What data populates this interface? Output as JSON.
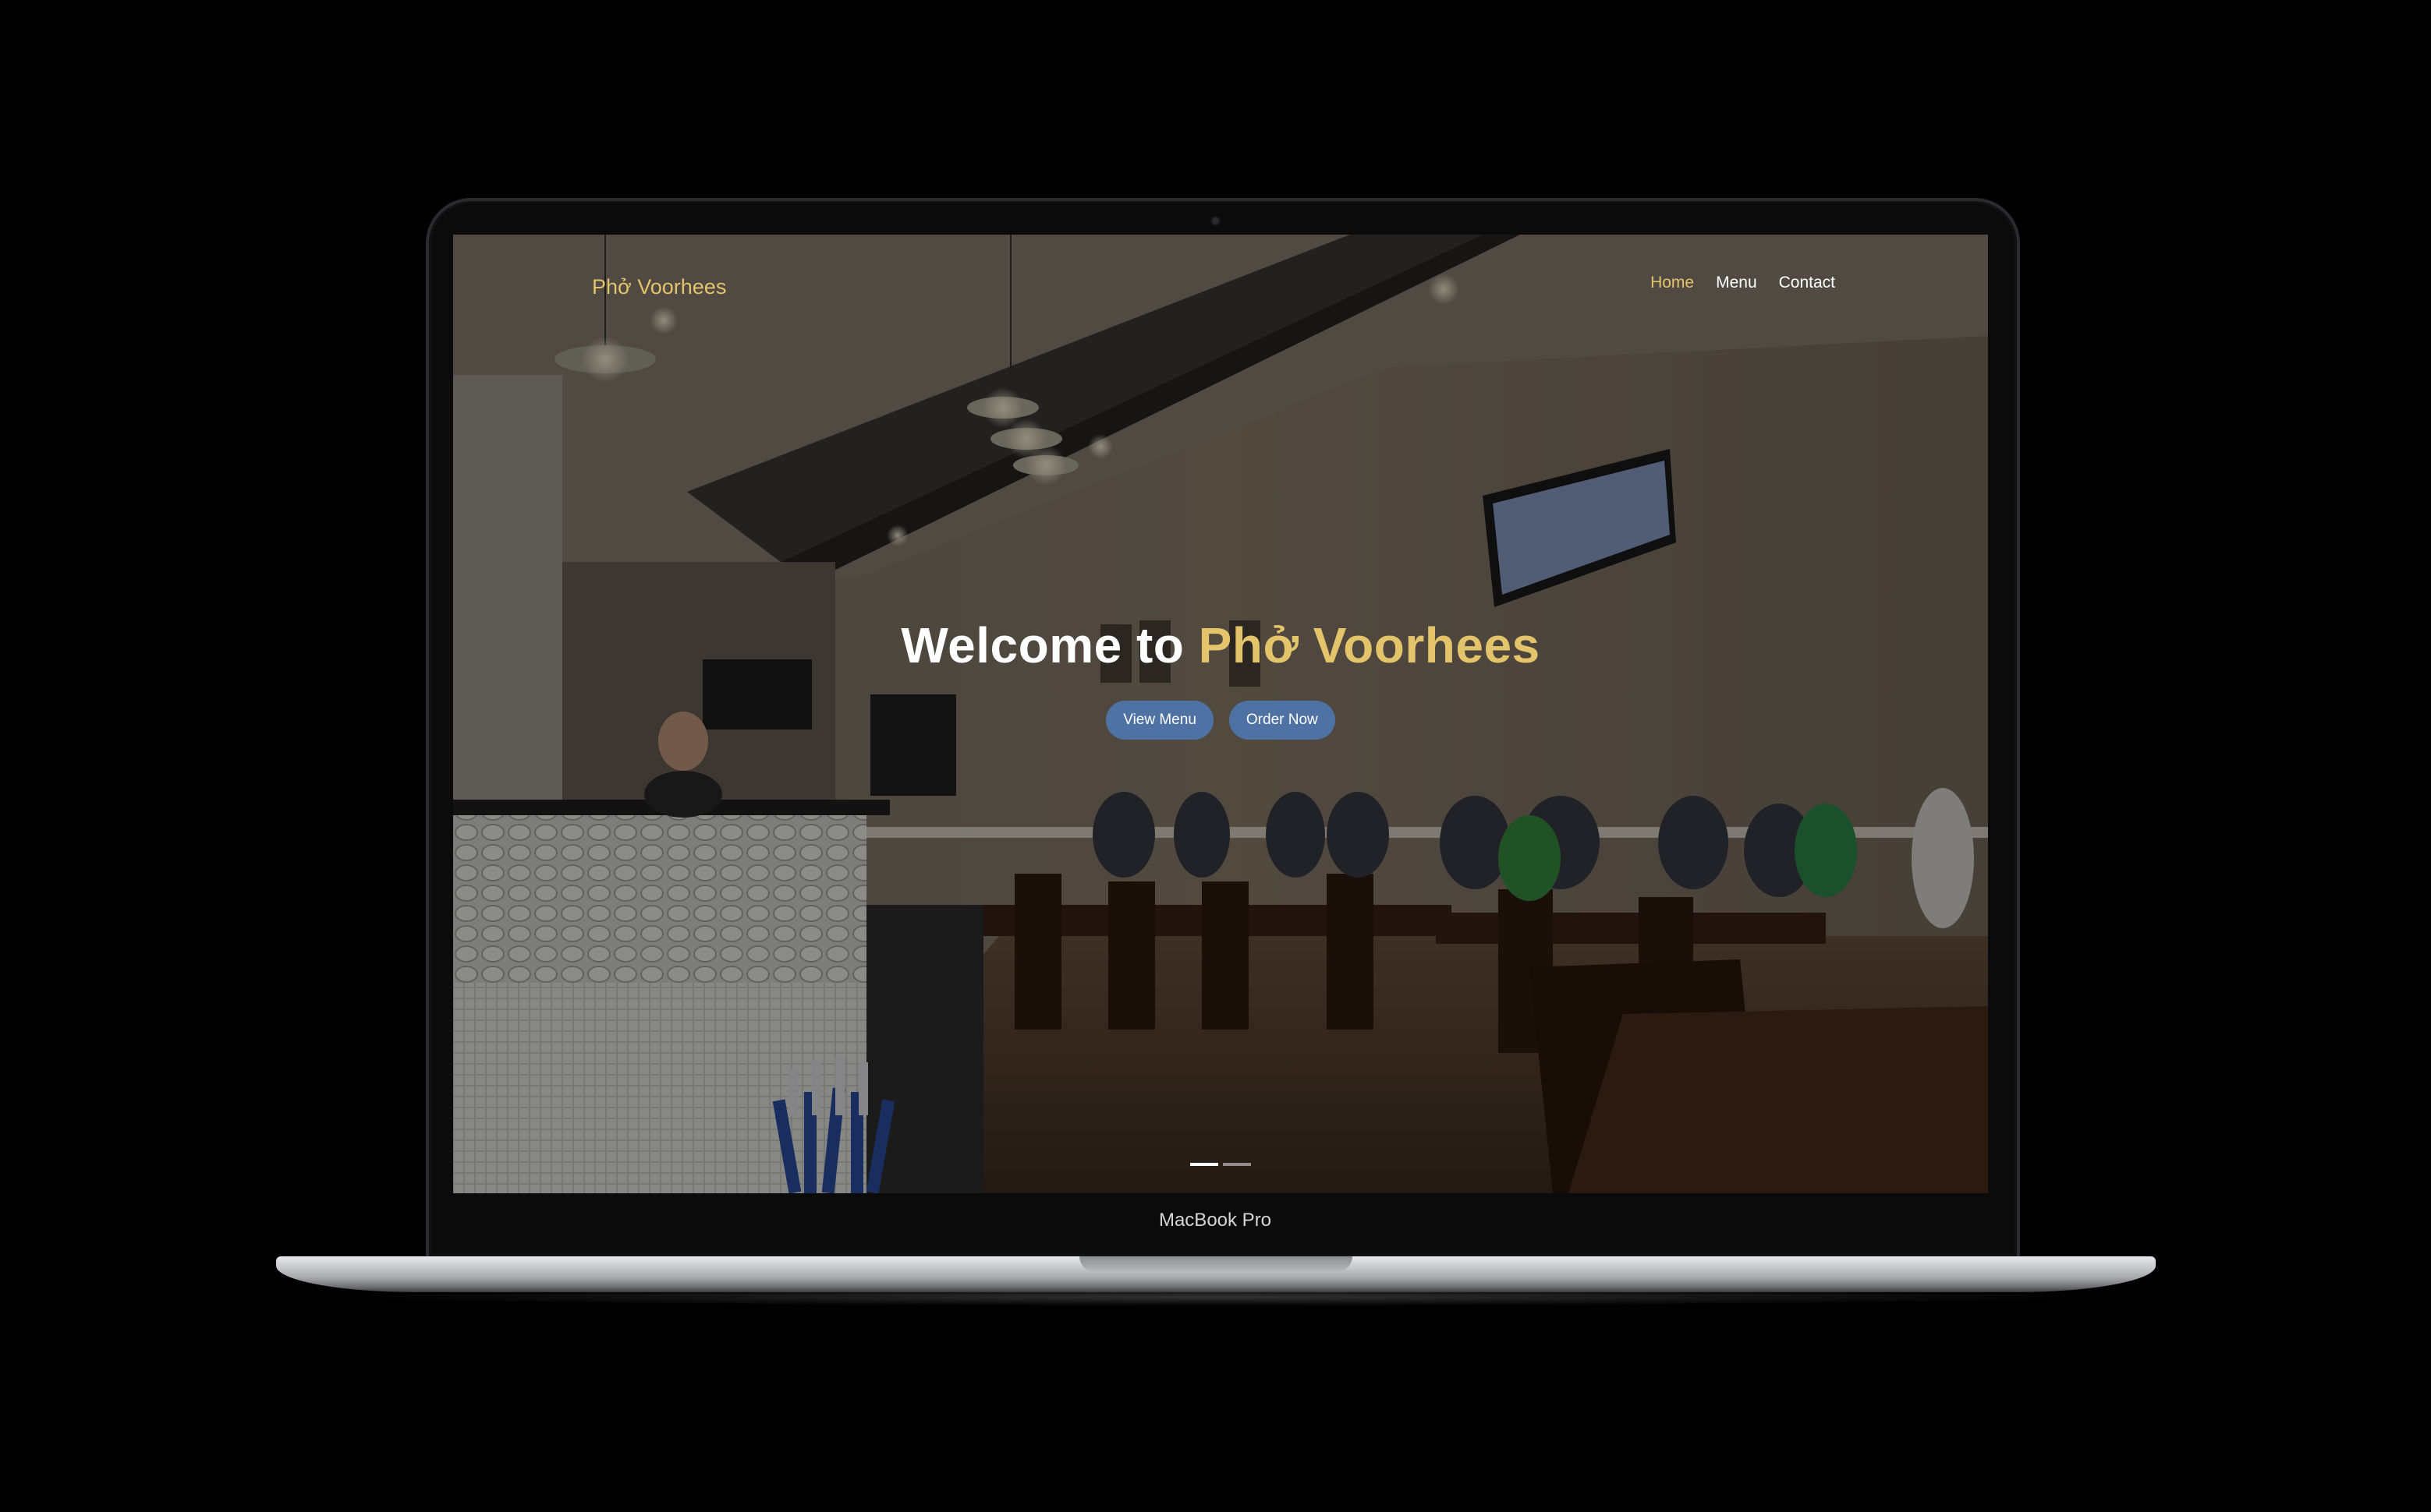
{
  "device": {
    "model_label": "MacBook Pro"
  },
  "site": {
    "brand": "Phở Voorhees",
    "nav": {
      "items": [
        {
          "label": "Home",
          "active": true
        },
        {
          "label": "Menu",
          "active": false
        },
        {
          "label": "Contact",
          "active": false
        }
      ]
    },
    "hero": {
      "title_prefix": "Welcome to ",
      "title_highlight": "Phở Voorhees",
      "buttons": [
        {
          "label": "View Menu"
        },
        {
          "label": "Order Now"
        }
      ]
    },
    "carousel": {
      "slide_count": 2,
      "active_index": 0
    }
  },
  "colors": {
    "accent_gold": "#e3c46b",
    "button_blue": "#4f72a4",
    "page_background": "#000000"
  },
  "icons": {
    "camera": "camera-dot-icon"
  }
}
